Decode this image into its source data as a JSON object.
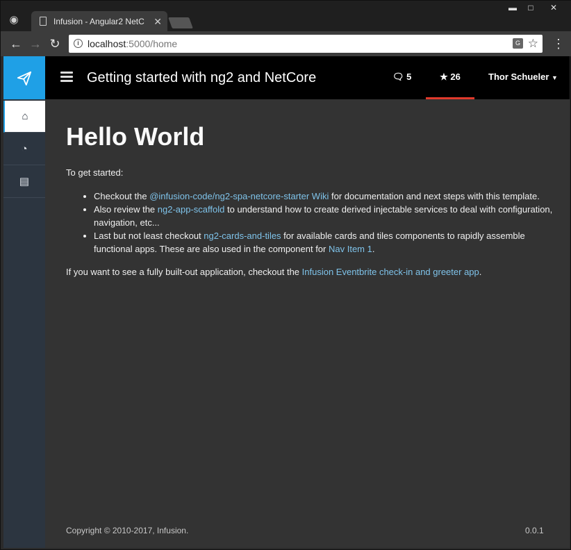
{
  "browser": {
    "tab_title": "Infusion - Angular2 NetC",
    "url_host": "localhost",
    "url_path": ":5000/home"
  },
  "app": {
    "title": "Getting started with ng2 and NetCore",
    "comments_count": "5",
    "stars_count": "26",
    "user_name": "Thor Schueler"
  },
  "sidebar": {
    "items": [
      {
        "icon": "home-icon"
      },
      {
        "icon": "dashboard-icon"
      },
      {
        "icon": "document-icon"
      }
    ]
  },
  "content": {
    "heading": "Hello World",
    "intro": "To get started:",
    "bullets": [
      {
        "pre": "Checkout the ",
        "link": "@infusion-code/ng2-spa-netcore-starter Wiki",
        "post": " for documentation and next steps with this template."
      },
      {
        "pre": "Also review the ",
        "link": "ng2-app-scaffold",
        "post": " to understand how to create derived injectable services to deal with configuration, navigation, etc..."
      },
      {
        "pre": "Last but not least checkout ",
        "link": "ng2-cards-and-tiles",
        "mid": " for available cards and tiles components to rapidly assemble functional apps. These are also used in the component for ",
        "link2": "Nav Item 1",
        "post": "."
      }
    ],
    "outro_pre": "If you want to see a fully built-out application, checkout the ",
    "outro_link": "Infusion Eventbrite check-in and greeter app",
    "outro_post": "."
  },
  "footer": {
    "copyright": "Copyright © 2010-2017, Infusion.",
    "version": "0.0.1"
  },
  "colors": {
    "brand": "#1fa0e6",
    "active_underline": "#e03a2c",
    "link": "#7fc3ea"
  }
}
